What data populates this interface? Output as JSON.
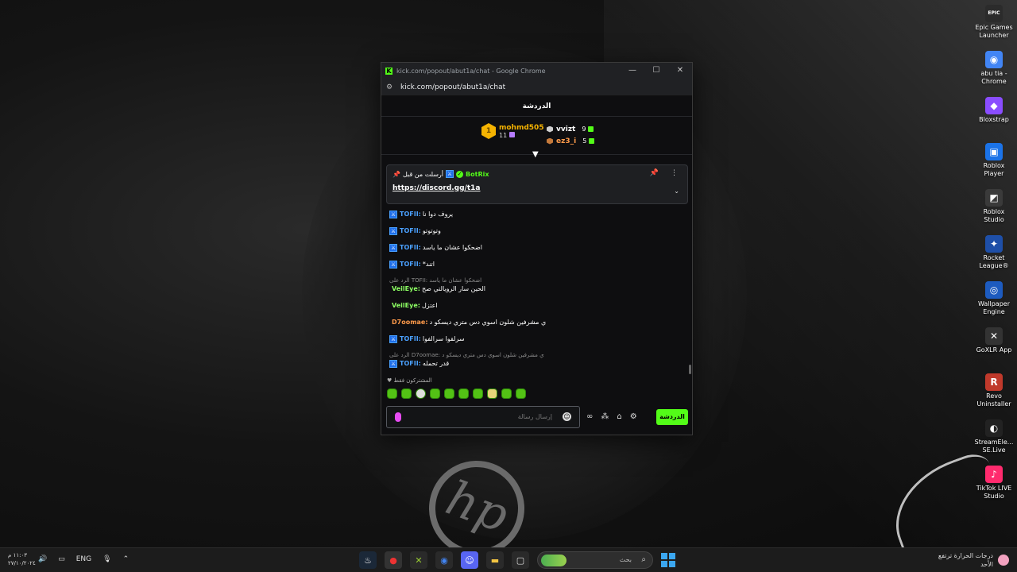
{
  "window": {
    "title": "kick.com/popout/abut1a/chat - Google Chrome",
    "url": "kick.com/popout/abut1a/chat",
    "favicon": "K"
  },
  "chat": {
    "header": "الدردشة",
    "leaderboard": {
      "first": {
        "rank": "1",
        "name": "mohmd505",
        "count": "11"
      },
      "second": {
        "name": "vvizt",
        "count": "9"
      },
      "third": {
        "name": "ez3_i",
        "count": "5"
      }
    },
    "pinned": {
      "label": "أرسلت من قبل",
      "user": "BotRix",
      "link": "https://discord.gg/t1a"
    },
    "messages": [
      {
        "user": "TOFII:",
        "text": "يروف دوا نا",
        "color": "#4aa0ff",
        "badge": true
      },
      {
        "user": "TOFII:",
        "text": "وتوتوتو",
        "color": "#4aa0ff",
        "badge": true
      },
      {
        "user": "TOFII:",
        "text": "اضحكوا عشان ما ياسد",
        "color": "#4aa0ff",
        "badge": true
      },
      {
        "user": "TOFII:",
        "text": "*اتند",
        "color": "#4aa0ff",
        "badge": true
      }
    ],
    "reply1": {
      "reply": "الرد على TOFII: اضحكوا عشان ما ياسد",
      "user": "VeilEye:",
      "text": "الحين سار الرويالتي صح",
      "color": "#8dff63"
    },
    "msg_veileye2": {
      "user": "VeilEye:",
      "text": "اعتزل",
      "color": "#8dff63"
    },
    "msg_d7oomae": {
      "user": "D7oomae:",
      "text": "ي مشرفين شلون اسوي دس متري ديسكو د",
      "color": "#ff9a4a"
    },
    "msg_tofii5": {
      "user": "TOFII:",
      "text": "سرلفوا سرالفوا",
      "color": "#4aa0ff"
    },
    "reply2": {
      "reply": "الرد على D7oomae: ي مشرفين شلون اسوي دس متري ديسكو د",
      "user": "TOFII:",
      "text": "قدر تحمله",
      "color": "#4aa0ff"
    },
    "subs_only": "المشتركون فقط",
    "input_placeholder": "إرسال رسالة",
    "send_label": "الدردشة"
  },
  "desktop_icons": [
    {
      "label": "Epic Games Launcher",
      "icon": "epic-games-icon",
      "color": "#2b2b2b",
      "glyph": "EPIC"
    },
    {
      "label": "abu tia - Chrome",
      "icon": "chrome-icon",
      "color": "#4285f4",
      "glyph": "◉"
    },
    {
      "label": "Bloxstrap",
      "icon": "bloxstrap-icon",
      "color": "#8a4dff",
      "glyph": "◆"
    },
    {
      "label": "Roblox Player",
      "icon": "roblox-icon",
      "color": "#1b73e8",
      "glyph": "▣"
    },
    {
      "label": "Roblox Studio",
      "icon": "roblox-studio-icon",
      "color": "#3a3a3a",
      "glyph": "◩"
    },
    {
      "label": "Rocket League®",
      "icon": "rocket-league-icon",
      "color": "#1e4fa8",
      "glyph": "✦"
    },
    {
      "label": "Wallpaper Engine",
      "icon": "wallpaper-engine-icon",
      "color": "#1d5bbf",
      "glyph": "◎"
    },
    {
      "label": "GoXLR App",
      "icon": "goxlr-icon",
      "color": "#333333",
      "glyph": "✕"
    },
    {
      "label": "Revo Uninstaller",
      "icon": "revo-icon",
      "color": "#c0392b",
      "glyph": "R"
    },
    {
      "label": "StreamEle... SE.Live",
      "icon": "streamelements-icon",
      "color": "#222222",
      "glyph": "◐"
    },
    {
      "label": "TikTok LIVE Studio",
      "icon": "tiktok-icon",
      "color": "#ff2a6d",
      "glyph": "♪"
    }
  ],
  "taskbar": {
    "time": "١١:٠٣ م",
    "date": "٢٧/١٠/٢٠٢٤",
    "lang": "ENG",
    "search_text": "بحث",
    "weather_line1": "درجات الحرارة ترتفع",
    "weather_line2": "الأحد"
  }
}
